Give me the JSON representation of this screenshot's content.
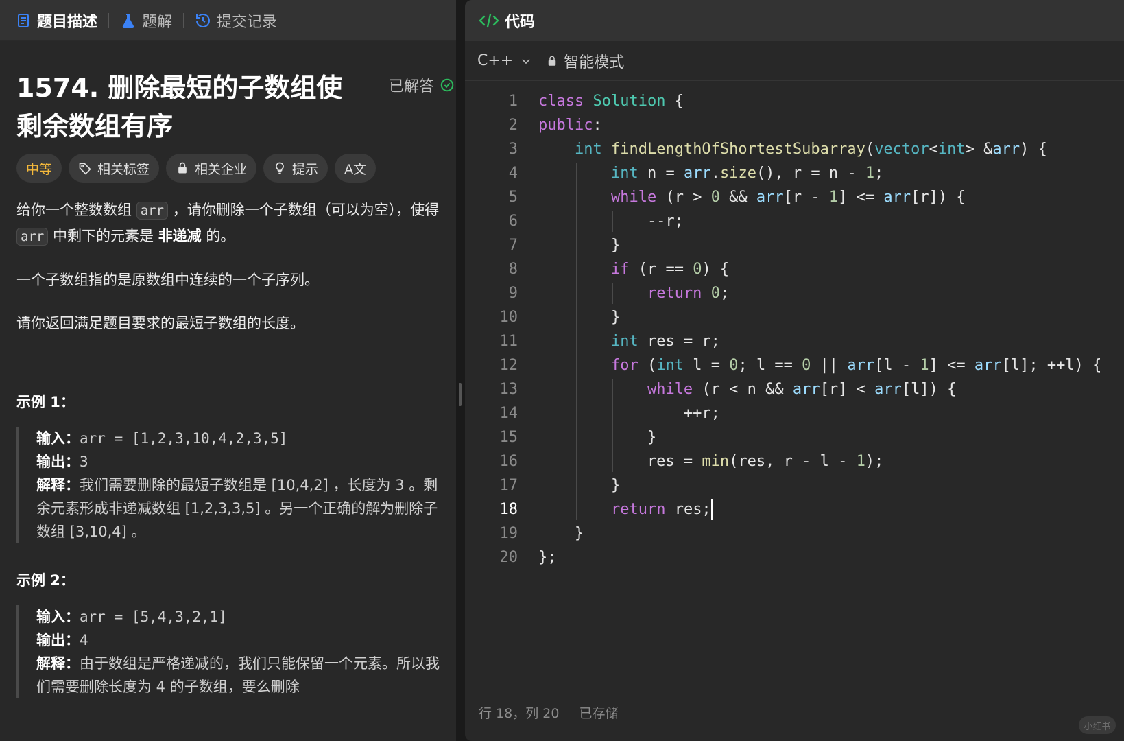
{
  "left_tabs": {
    "description": "题目描述",
    "solutions": "题解",
    "submissions": "提交记录"
  },
  "problem": {
    "title": "1574. 删除最短的子数组使剩余数组有序",
    "solved": "已解答"
  },
  "tags": {
    "difficulty": "中等",
    "topics": "相关标签",
    "companies": "相关企业",
    "hint": "提示",
    "translate": "A文"
  },
  "description": {
    "p1_a": "给你一个整数数组 ",
    "p1_code1": "arr",
    "p1_b": " ，请你删除一个子数组（可以为空），使得 ",
    "p1_code2": "arr",
    "p1_c": " 中剩下的元素是 ",
    "p1_bold": "非递减",
    "p1_d": " 的。",
    "p2": "一个子数组指的是原数组中连续的一个子序列。",
    "p3": "请你返回满足题目要求的最短子数组的长度。"
  },
  "examples": [
    {
      "title": "示例 1：",
      "input_label": "输入：",
      "input": "arr = [1,2,3,10,4,2,3,5]",
      "output_label": "输出：",
      "output": "3",
      "explain_label": "解释：",
      "explain": "我们需要删除的最短子数组是 [10,4,2] ，长度为 3 。剩余元素形成非递减数组 [1,2,3,3,5] 。另一个正确的解为删除子数组 [3,10,4] 。"
    },
    {
      "title": "示例 2：",
      "input_label": "输入：",
      "input": "arr = [5,4,3,2,1]",
      "output_label": "输出：",
      "output": "4",
      "explain_label": "解释：",
      "explain": "由于数组是严格递减的，我们只能保留一个元素。所以我们需要删除长度为 4 的子数组，要么删除"
    }
  ],
  "editor": {
    "header_title": "代码",
    "language": "C++",
    "mode": "智能模式",
    "current_line": 18,
    "lines": [
      "class Solution {",
      "public:",
      "    int findLengthOfShortestSubarray(vector<int> &arr) {",
      "        int n = arr.size(), r = n - 1;",
      "        while (r > 0 && arr[r - 1] <= arr[r]) {",
      "            --r;",
      "        }",
      "        if (r == 0) {",
      "            return 0;",
      "        }",
      "        int res = r;",
      "        for (int l = 0; l == 0 || arr[l - 1] <= arr[l]; ++l) {",
      "            while (r < n && arr[r] < arr[l]) {",
      "                ++r;",
      "            }",
      "            res = min(res, r - l - 1);",
      "        }",
      "        return res;",
      "    }",
      "};"
    ]
  },
  "status": {
    "position": "行 18，列 20",
    "saved": "已存储"
  },
  "watermark": "小红书",
  "colors": {
    "difficulty_medium": "#f5b93b",
    "solved_check": "#2cbb5d",
    "keyword": "#c678dd",
    "type": "#56b6c2",
    "class_name": "#4ec9b0",
    "function": "#dcdcaa",
    "number": "#b5cea8"
  }
}
